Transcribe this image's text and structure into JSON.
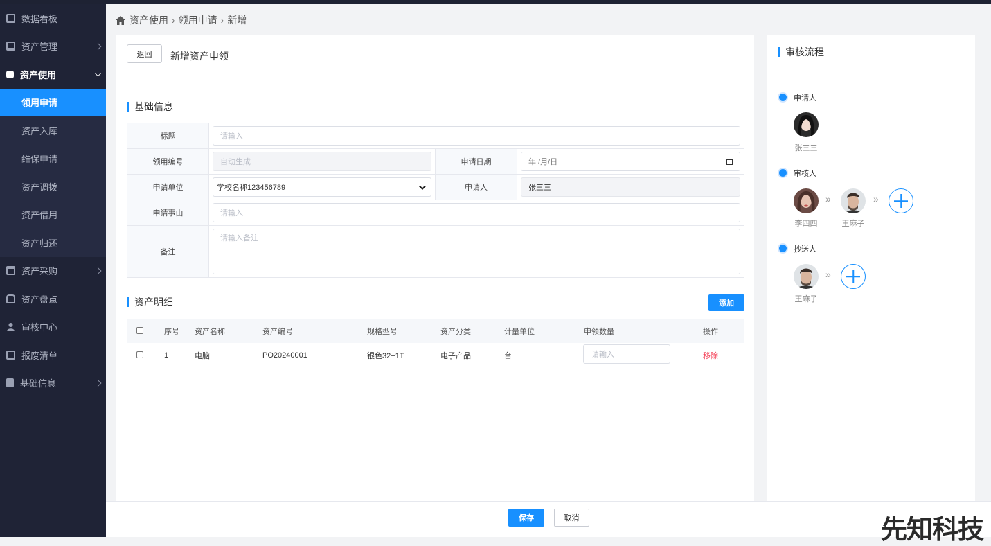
{
  "sidebar": {
    "items": [
      {
        "label": "数据看板",
        "icon": "chart-icon"
      },
      {
        "label": "资产管理",
        "icon": "server-icon"
      },
      {
        "label": "资产使用",
        "icon": "asset-use-icon"
      },
      {
        "label": "资产采购",
        "icon": "wallet-icon"
      },
      {
        "label": "资产盘点",
        "icon": "car-icon"
      },
      {
        "label": "审核中心",
        "icon": "user-icon"
      },
      {
        "label": "报废清单",
        "icon": "receipt-icon"
      },
      {
        "label": "基础信息",
        "icon": "document-icon"
      }
    ],
    "sub_items": [
      "领用申请",
      "资产入库",
      "维保申请",
      "资产调拨",
      "资产借用",
      "资产归还"
    ]
  },
  "breadcrumb": [
    "资产使用",
    "领用申请",
    "新增"
  ],
  "header": {
    "back_label": "返回",
    "title": "新增资产申领"
  },
  "basic": {
    "section_title": "基础信息",
    "title_label": "标题",
    "title_placeholder": "请输入",
    "code_label": "领用编号",
    "code_value": "自动生成",
    "date_label": "申请日期",
    "date_placeholder": "年 /月/日",
    "unit_label": "申请单位",
    "unit_value": "学校名称123456789",
    "applicant_label": "申请人",
    "applicant_value": "张三三",
    "reason_label": "申请事由",
    "reason_placeholder": "请输入",
    "remark_label": "备注",
    "remark_placeholder": "请输入备注"
  },
  "detail": {
    "section_title": "资产明细",
    "add_label": "添加",
    "columns": [
      "序号",
      "资产名称",
      "资产编号",
      "规格型号",
      "资产分类",
      "计量单位",
      "申领数量",
      "操作"
    ],
    "rows": [
      {
        "no": "1",
        "name": "电脑",
        "code": "PO20240001",
        "spec": "银色32+1T",
        "category": "电子产品",
        "unit": "台",
        "qty_placeholder": "请输入",
        "action": "移除"
      }
    ]
  },
  "flow": {
    "title": "审核流程",
    "applicant_label": "申请人",
    "applicants": [
      "张三三"
    ],
    "approver_label": "审核人",
    "approvers": [
      "李四四",
      "王麻子"
    ],
    "cc_label": "抄送人",
    "cc": [
      "王麻子"
    ],
    "arrow_glyph": "»"
  },
  "footer": {
    "save_label": "保存",
    "cancel_label": "取消"
  },
  "watermark": "先知科技",
  "colors": {
    "accent": "#1890ff",
    "sidebar": "#1f2336",
    "danger": "#f5475d"
  }
}
